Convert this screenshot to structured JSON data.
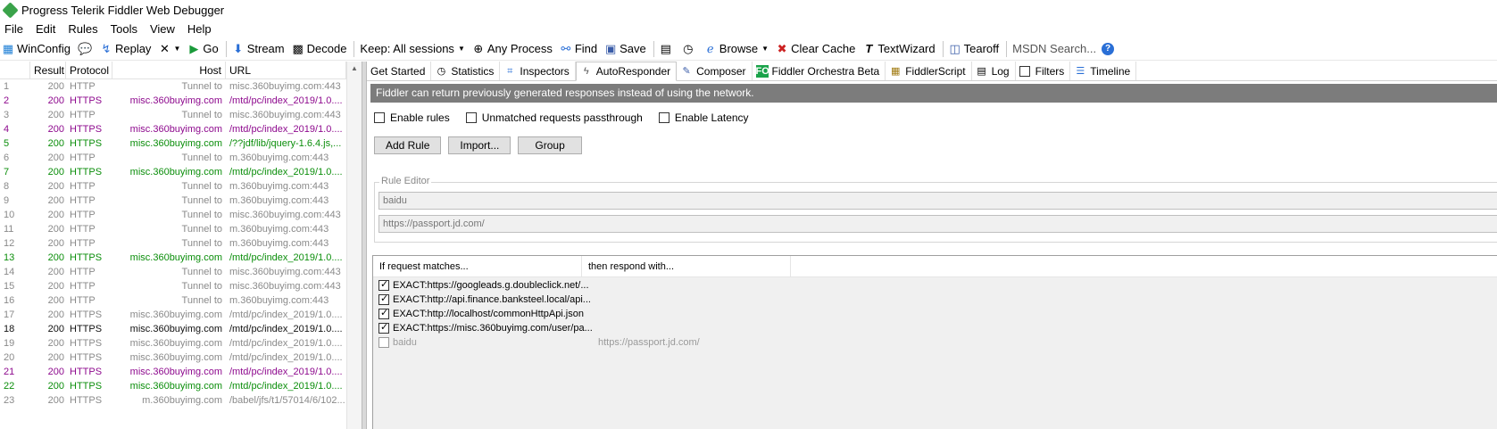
{
  "window": {
    "title": "Progress Telerik Fiddler Web Debugger"
  },
  "menu": [
    "File",
    "Edit",
    "Rules",
    "Tools",
    "View",
    "Help"
  ],
  "toolbar": {
    "winconfig": "WinConfig",
    "replay": "Replay",
    "go": "Go",
    "stream": "Stream",
    "decode": "Decode",
    "keep": "Keep: All sessions",
    "any_process": "Any Process",
    "find": "Find",
    "save": "Save",
    "browse": "Browse",
    "clear_cache": "Clear Cache",
    "textwizard": "TextWizard",
    "tearoff": "Tearoff",
    "search_placeholder": "MSDN Search..."
  },
  "sessions": {
    "columns": {
      "result": "Result",
      "protocol": "Protocol",
      "host": "Host",
      "url": "URL"
    },
    "rows": [
      {
        "num": "1",
        "result": "200",
        "protocol": "HTTP",
        "host": "Tunnel to",
        "url": "misc.360buyimg.com:443",
        "color": "grey"
      },
      {
        "num": "2",
        "result": "200",
        "protocol": "HTTPS",
        "host": "misc.360buyimg.com",
        "url": "/mtd/pc/index_2019/1.0....",
        "color": "purple"
      },
      {
        "num": "3",
        "result": "200",
        "protocol": "HTTP",
        "host": "Tunnel to",
        "url": "misc.360buyimg.com:443",
        "color": "grey"
      },
      {
        "num": "4",
        "result": "200",
        "protocol": "HTTPS",
        "host": "misc.360buyimg.com",
        "url": "/mtd/pc/index_2019/1.0....",
        "color": "purple"
      },
      {
        "num": "5",
        "result": "200",
        "protocol": "HTTPS",
        "host": "misc.360buyimg.com",
        "url": "/??jdf/lib/jquery-1.6.4.js,...",
        "color": "green"
      },
      {
        "num": "6",
        "result": "200",
        "protocol": "HTTP",
        "host": "Tunnel to",
        "url": "m.360buyimg.com:443",
        "color": "grey"
      },
      {
        "num": "7",
        "result": "200",
        "protocol": "HTTPS",
        "host": "misc.360buyimg.com",
        "url": "/mtd/pc/index_2019/1.0....",
        "color": "green"
      },
      {
        "num": "8",
        "result": "200",
        "protocol": "HTTP",
        "host": "Tunnel to",
        "url": "m.360buyimg.com:443",
        "color": "grey"
      },
      {
        "num": "9",
        "result": "200",
        "protocol": "HTTP",
        "host": "Tunnel to",
        "url": "m.360buyimg.com:443",
        "color": "grey"
      },
      {
        "num": "10",
        "result": "200",
        "protocol": "HTTP",
        "host": "Tunnel to",
        "url": "misc.360buyimg.com:443",
        "color": "grey"
      },
      {
        "num": "11",
        "result": "200",
        "protocol": "HTTP",
        "host": "Tunnel to",
        "url": "m.360buyimg.com:443",
        "color": "grey"
      },
      {
        "num": "12",
        "result": "200",
        "protocol": "HTTP",
        "host": "Tunnel to",
        "url": "m.360buyimg.com:443",
        "color": "grey"
      },
      {
        "num": "13",
        "result": "200",
        "protocol": "HTTPS",
        "host": "misc.360buyimg.com",
        "url": "/mtd/pc/index_2019/1.0....",
        "color": "green"
      },
      {
        "num": "14",
        "result": "200",
        "protocol": "HTTP",
        "host": "Tunnel to",
        "url": "misc.360buyimg.com:443",
        "color": "grey"
      },
      {
        "num": "15",
        "result": "200",
        "protocol": "HTTP",
        "host": "Tunnel to",
        "url": "misc.360buyimg.com:443",
        "color": "grey"
      },
      {
        "num": "16",
        "result": "200",
        "protocol": "HTTP",
        "host": "Tunnel to",
        "url": "m.360buyimg.com:443",
        "color": "grey"
      },
      {
        "num": "17",
        "result": "200",
        "protocol": "HTTPS",
        "host": "misc.360buyimg.com",
        "url": "/mtd/pc/index_2019/1.0....",
        "color": "grey"
      },
      {
        "num": "18",
        "result": "200",
        "protocol": "HTTPS",
        "host": "misc.360buyimg.com",
        "url": "/mtd/pc/index_2019/1.0....",
        "color": "black"
      },
      {
        "num": "19",
        "result": "200",
        "protocol": "HTTPS",
        "host": "misc.360buyimg.com",
        "url": "/mtd/pc/index_2019/1.0....",
        "color": "grey"
      },
      {
        "num": "20",
        "result": "200",
        "protocol": "HTTPS",
        "host": "misc.360buyimg.com",
        "url": "/mtd/pc/index_2019/1.0....",
        "color": "grey"
      },
      {
        "num": "21",
        "result": "200",
        "protocol": "HTTPS",
        "host": "misc.360buyimg.com",
        "url": "/mtd/pc/index_2019/1.0....",
        "color": "purple"
      },
      {
        "num": "22",
        "result": "200",
        "protocol": "HTTPS",
        "host": "misc.360buyimg.com",
        "url": "/mtd/pc/index_2019/1.0....",
        "color": "green"
      },
      {
        "num": "23",
        "result": "200",
        "protocol": "HTTPS",
        "host": "m.360buyimg.com",
        "url": "/babel/jfs/t1/57014/6/102...",
        "color": "grey"
      }
    ]
  },
  "tabs": [
    {
      "label": "Get Started",
      "icon": "",
      "active": false
    },
    {
      "label": "Statistics",
      "icon": "clock-icon",
      "active": false
    },
    {
      "label": "Inspectors",
      "icon": "inspect-icon",
      "active": false
    },
    {
      "label": "AutoResponder",
      "icon": "lightning-icon",
      "active": true
    },
    {
      "label": "Composer",
      "icon": "composer-icon",
      "active": false
    },
    {
      "label": "Fiddler Orchestra Beta",
      "icon": "fo-icon",
      "active": false
    },
    {
      "label": "FiddlerScript",
      "icon": "script-icon",
      "active": false
    },
    {
      "label": "Log",
      "icon": "log-icon",
      "active": false
    },
    {
      "label": "Filters",
      "icon": "filter-checkbox-icon",
      "active": false
    },
    {
      "label": "Timeline",
      "icon": "timeline-icon",
      "active": false
    }
  ],
  "autoresponder": {
    "banner": "Fiddler can return previously generated responses instead of using the network.",
    "enable_rules": "Enable rules",
    "unmatched": "Unmatched requests passthrough",
    "enable_latency": "Enable Latency",
    "add_rule": "Add Rule",
    "import": "Import...",
    "group": "Group",
    "rule_editor_label": "Rule Editor",
    "match_field": "baidu",
    "respond_field": "https://passport.jd.com/",
    "col_match": "If request matches...",
    "col_respond": "then respond with...",
    "rules": [
      {
        "match": "EXACT:https://googleads.g.doubleclick.net/...",
        "respond": "",
        "checked": true
      },
      {
        "match": "EXACT:http://api.finance.banksteel.local/api...",
        "respond": "",
        "checked": true
      },
      {
        "match": "EXACT:http://localhost/commonHttpApi.json",
        "respond": "",
        "checked": true
      },
      {
        "match": "EXACT:https://misc.360buyimg.com/user/pa...",
        "respond": "",
        "checked": true
      },
      {
        "match": "baidu",
        "respond": "https://passport.jd.com/",
        "checked": false
      }
    ]
  }
}
